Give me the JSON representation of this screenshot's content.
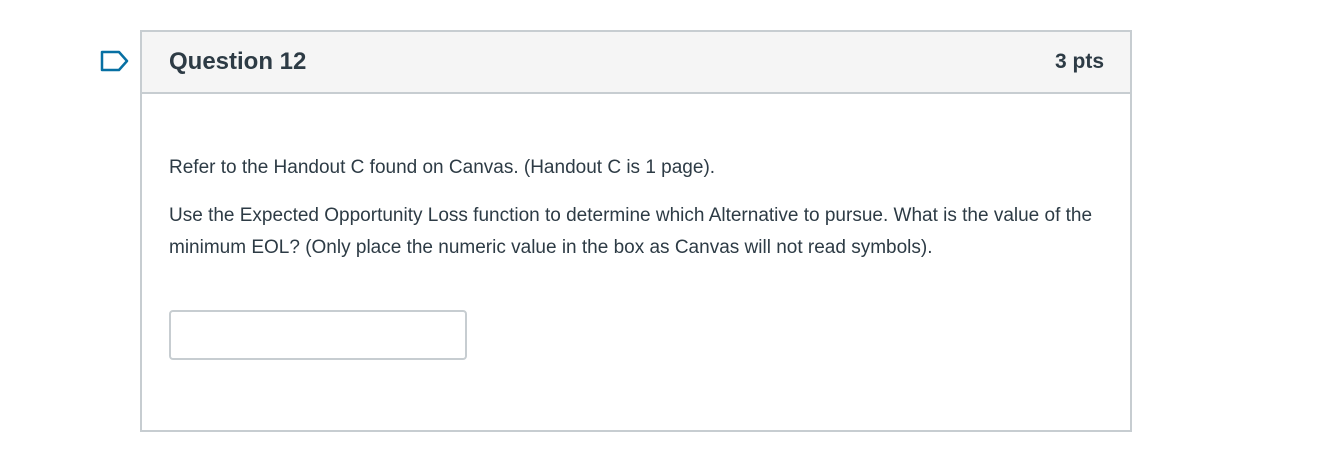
{
  "question": {
    "title": "Question 12",
    "points": "3 pts",
    "paragraphs": [
      "Refer to the Handout C found on Canvas.  (Handout C is 1 page).",
      "Use the Expected Opportunity Loss function to determine which Alternative to pursue. What is the value of the minimum EOL?  (Only place the numeric value in the box as Canvas will not read symbols)."
    ],
    "answer": {
      "value": "",
      "placeholder": ""
    }
  },
  "icons": {
    "flag": "flag-outline-icon"
  },
  "colors": {
    "border": "#c7cdd1",
    "header_bg": "#f5f5f5",
    "text": "#2d3b45",
    "flag": "#0770a3"
  }
}
